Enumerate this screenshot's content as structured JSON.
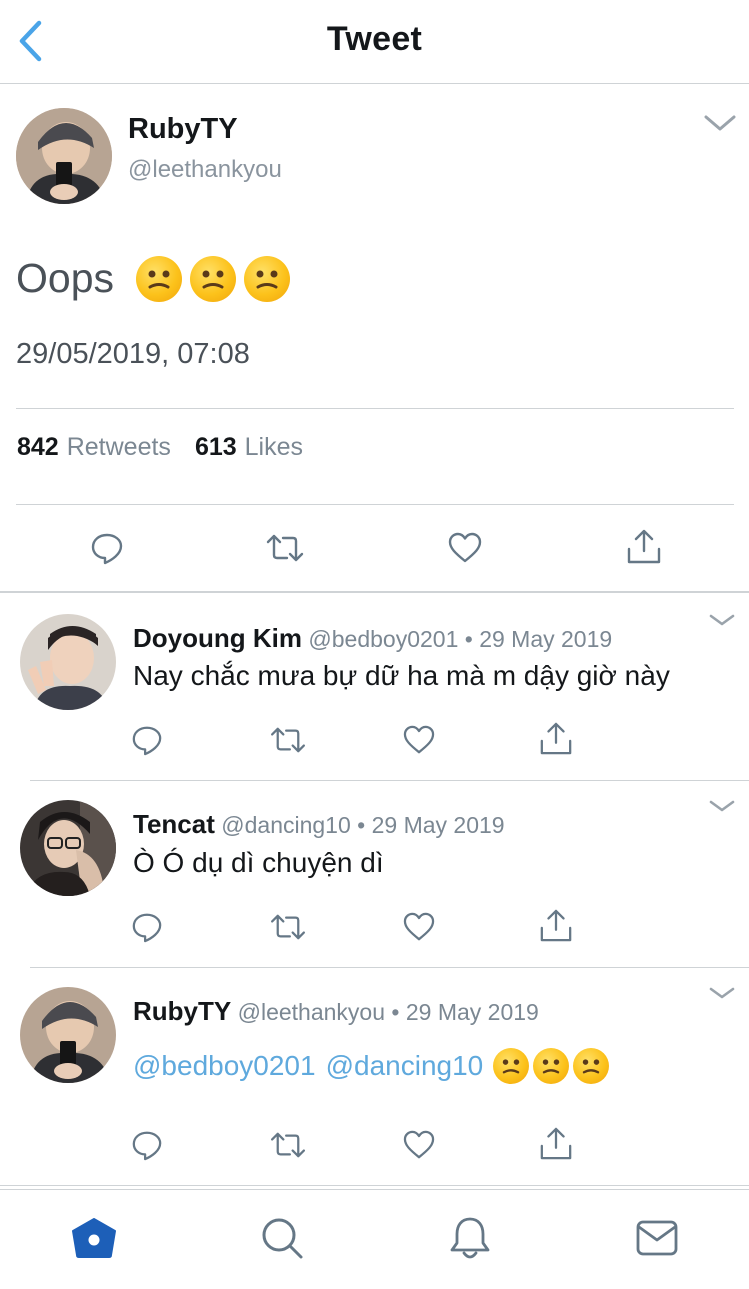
{
  "header": {
    "title": "Tweet"
  },
  "main_tweet": {
    "name": "RubyTY",
    "handle": "@leethankyou",
    "text": "Oops",
    "emoji_count": 3,
    "timestamp": "29/05/2019, 07:08",
    "retweets_count": "842",
    "retweets_label": "Retweets",
    "likes_count": "613",
    "likes_label": "Likes"
  },
  "replies": [
    {
      "name": "Doyoung Kim",
      "meta": "@bedboy0201 • 29 May 2019",
      "text": "Nay chắc mưa bự dữ ha mà m dậy giờ này"
    },
    {
      "name": "Tencat",
      "meta": "@dancing10 • 29 May 2019",
      "text": "Ò Ó dụ dì chuyện dì"
    },
    {
      "name": "RubyTY",
      "meta": "@leethankyou • 29 May 2019",
      "mention1": "@bedboy0201",
      "mention2": "@dancing10"
    }
  ],
  "tabs": [
    "home-icon",
    "search-icon",
    "bell-icon",
    "mail-icon"
  ],
  "colors": {
    "accent": "#1da1f2",
    "mention": "#5fa9dd",
    "muted": "#7b8792",
    "divider": "#cfd3d6"
  }
}
